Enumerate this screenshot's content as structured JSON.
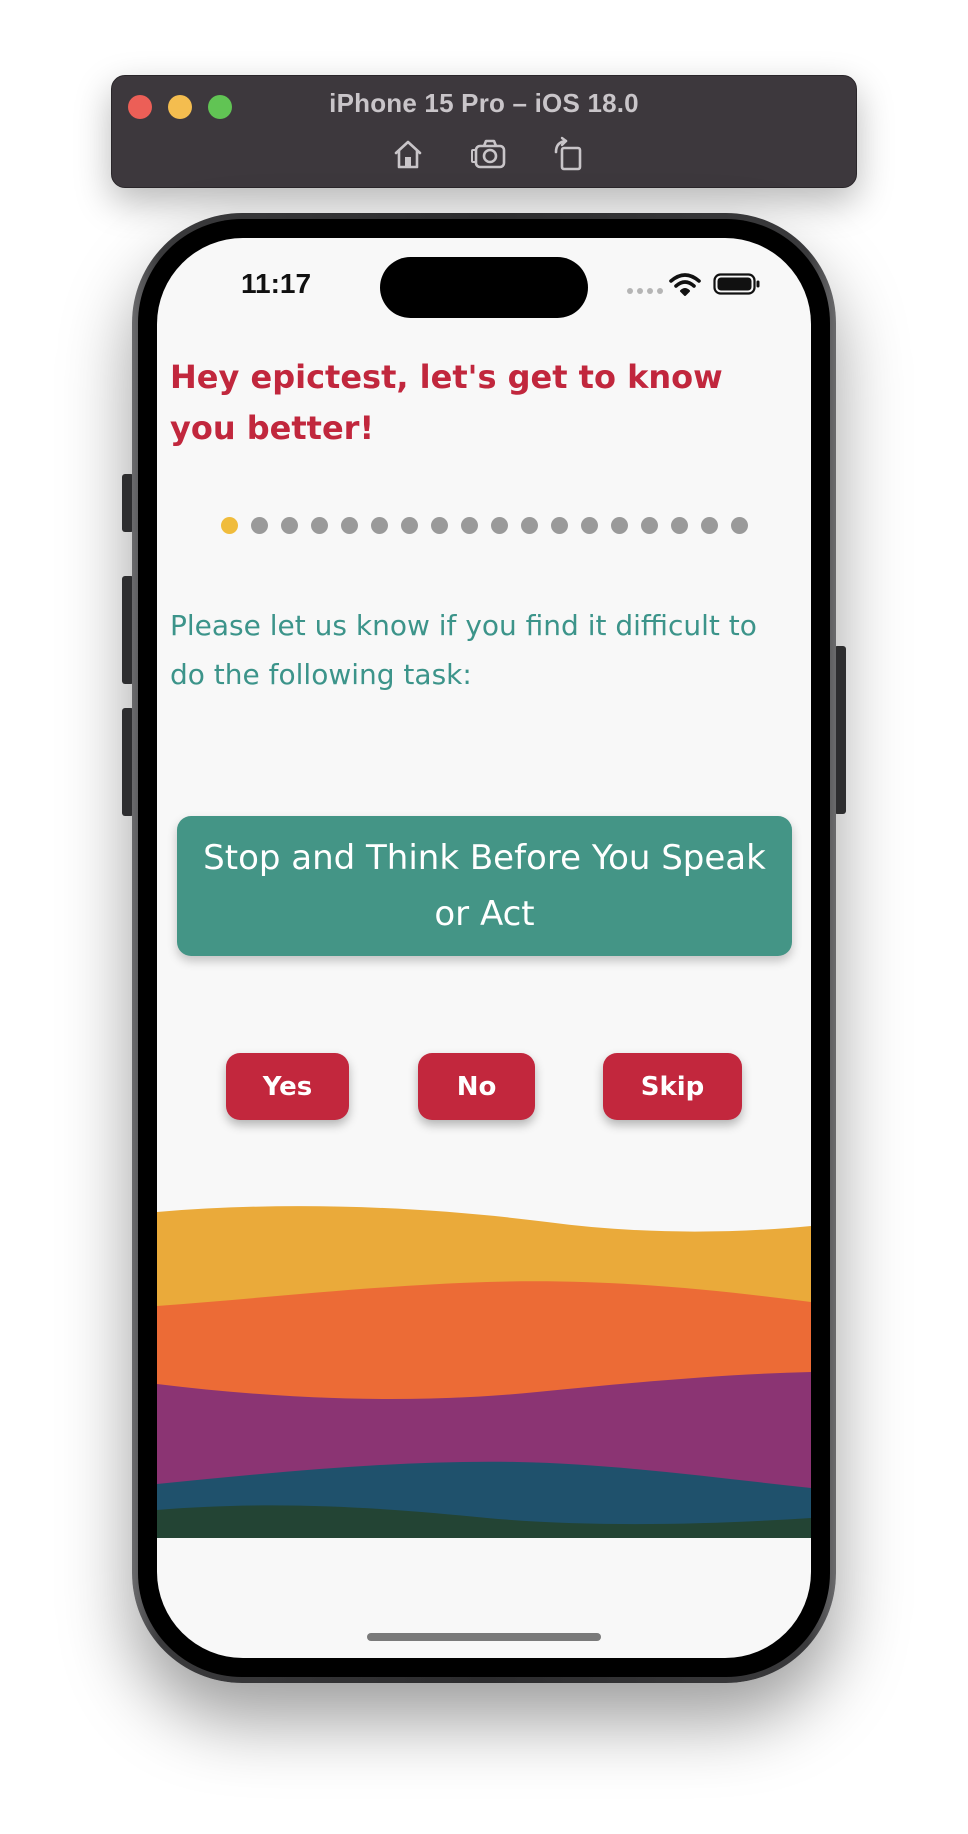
{
  "simulator": {
    "title": "iPhone 15 Pro – iOS 18.0",
    "tools": [
      "home-icon",
      "screenshot-icon",
      "rotate-icon"
    ]
  },
  "status_bar": {
    "time": "11:17"
  },
  "onboarding": {
    "greeting": "Hey epictest, let's get to know you better!",
    "progress": {
      "total_steps": 18,
      "current_step": 1
    },
    "prompt": "Please let us know if you find it difficult to do the following task:",
    "task": "Stop and Think Before You Speak or Act",
    "buttons": {
      "yes": "Yes",
      "no": "No",
      "skip": "Skip"
    }
  },
  "colors": {
    "primary_red": "#c2273d",
    "teal": "#449586",
    "active_dot": "#f0bc3c",
    "inactive_dot": "#9a9a9a",
    "wave_yellow": "#eaaa3a",
    "wave_orange": "#ec6b36",
    "wave_purple": "#8b3473",
    "wave_blue": "#1f516c",
    "wave_green": "#234434"
  }
}
